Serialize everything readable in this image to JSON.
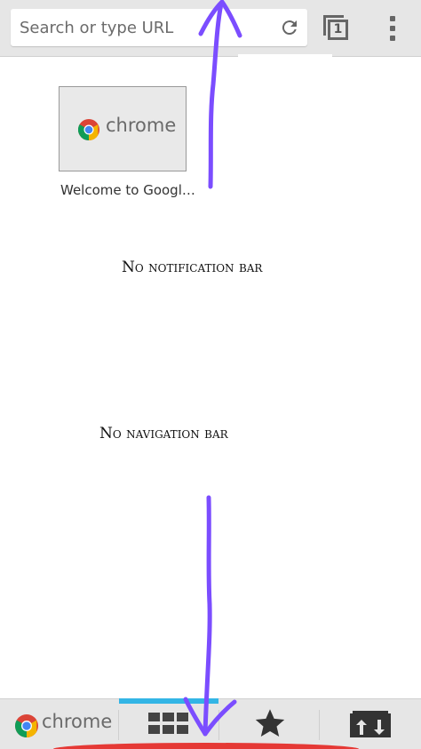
{
  "toolbar": {
    "search_placeholder": "Search or type URL",
    "tab_count": "1"
  },
  "thumbnail": {
    "logo_text": "chrome",
    "caption": "Welcome to Googl…"
  },
  "annotations": {
    "no_notification_bar": "No notification bar",
    "no_navigation_bar": "No navigation bar",
    "stroke_color": "#7b4dff"
  },
  "bottom_bar": {
    "chrome_label": "chrome",
    "active_indicator_color": "#33b5e5",
    "items": [
      {
        "icon": "chrome-logo-icon"
      },
      {
        "icon": "most-visited-grid-icon"
      },
      {
        "icon": "bookmarks-star-icon"
      },
      {
        "icon": "other-devices-sync-icon"
      }
    ]
  }
}
